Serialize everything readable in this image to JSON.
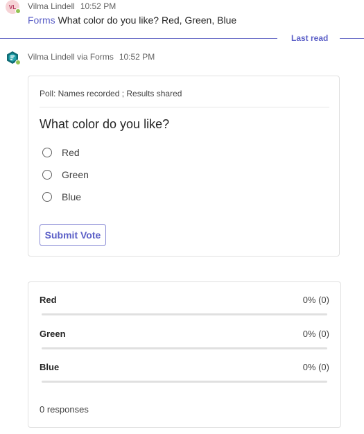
{
  "message1": {
    "avatar_initials": "VL",
    "sender": "Vilma Lindell",
    "time": "10:52 PM",
    "app_link": "Forms",
    "text": "What color do you like? Red, Green, Blue"
  },
  "divider": {
    "label": "Last read"
  },
  "message2": {
    "sender": "Vilma Lindell via Forms",
    "time": "10:52 PM"
  },
  "poll": {
    "meta": "Poll: Names recorded ; Results shared",
    "question": "What color do you like?",
    "options": [
      {
        "label": "Red"
      },
      {
        "label": "Green"
      },
      {
        "label": "Blue"
      }
    ],
    "submit_label": "Submit Vote"
  },
  "results": {
    "rows": [
      {
        "name": "Red",
        "percent_text": "0% (0)",
        "fraction": 0
      },
      {
        "name": "Green",
        "percent_text": "0% (0)",
        "fraction": 0
      },
      {
        "name": "Blue",
        "percent_text": "0% (0)",
        "fraction": 0
      }
    ],
    "responses": "0 responses"
  },
  "colors": {
    "accent": "#5b5fc7",
    "presence": "#92c353",
    "forms_icon": "#0f6b74"
  }
}
